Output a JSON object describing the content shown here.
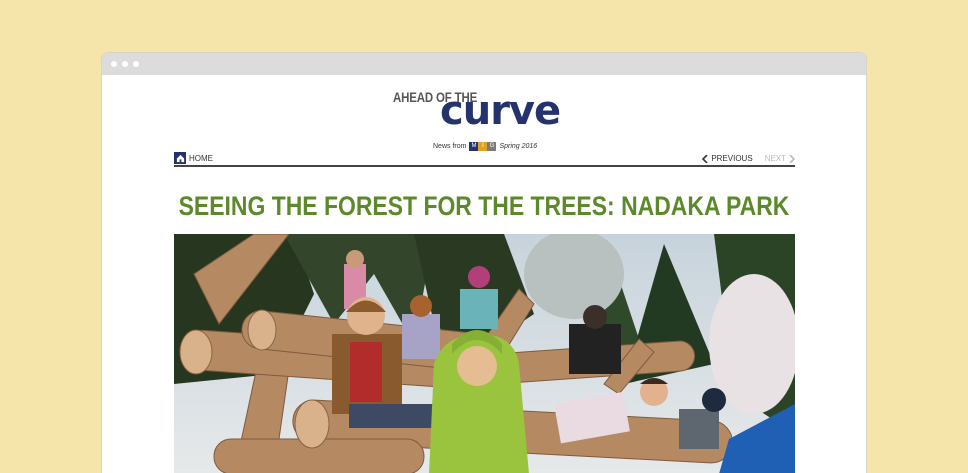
{
  "window": {
    "dots": [
      "",
      "",
      ""
    ]
  },
  "masthead": {
    "small": "AHEAD OF THE",
    "big": "curve",
    "news_from": "News from",
    "mig": [
      "M",
      "I",
      "G"
    ],
    "season": "Spring 2016"
  },
  "nav": {
    "home_label": "HOME",
    "previous_label": "PREVIOUS",
    "next_label": "NEXT"
  },
  "article": {
    "title": "SEEING THE FOREST FOR THE TREES: NADAKA PARK"
  },
  "colors": {
    "background": "#f6e5ab",
    "brand_navy": "#24336b",
    "title_green": "#5c8a2b"
  }
}
